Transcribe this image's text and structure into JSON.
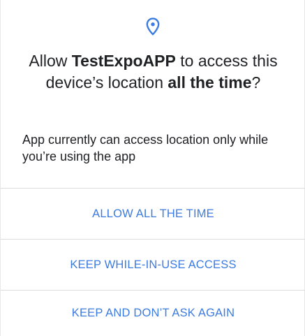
{
  "dialog": {
    "icon": "location-pin-icon",
    "title": {
      "prefix": "Allow ",
      "app_name": "TestExpoAPP",
      "middle": " to access this device’s location ",
      "emphasis": "all the time",
      "suffix": "?"
    },
    "message": "App currently can access location only while you’re using the app",
    "actions": [
      {
        "label": "ALLOW ALL THE TIME"
      },
      {
        "label": "KEEP WHILE-IN-USE ACCESS"
      },
      {
        "label": "KEEP AND DON’T ASK AGAIN"
      }
    ]
  },
  "colors": {
    "accent": "#3c7be0",
    "text": "#202124",
    "divider": "#dcdcdc",
    "background": "#ffffff"
  }
}
